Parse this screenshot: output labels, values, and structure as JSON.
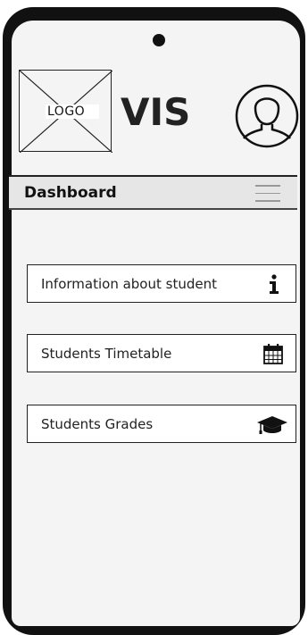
{
  "header": {
    "logo_label": "LOGO",
    "app_title": "VIS"
  },
  "section": {
    "title": "Dashboard"
  },
  "nav": {
    "items": [
      {
        "label": "Information about student",
        "icon": "info-icon"
      },
      {
        "label": "Students Timetable",
        "icon": "calendar-icon"
      },
      {
        "label": "Students Grades",
        "icon": "graduation-cap-icon"
      }
    ]
  },
  "colors": {
    "frame": "#111111",
    "screen": "#f4f4f4",
    "bar": "#e6e6e6"
  }
}
